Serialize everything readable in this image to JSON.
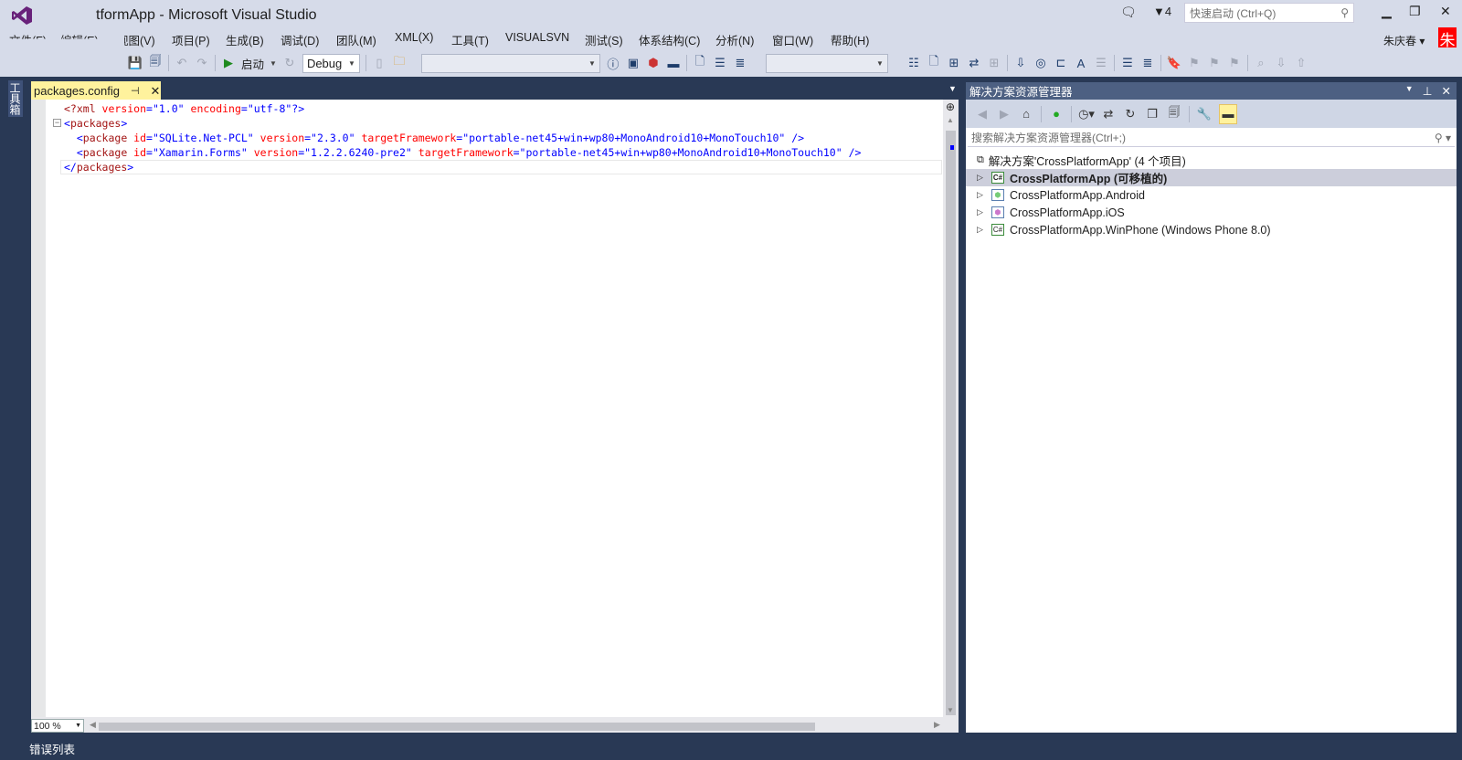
{
  "window": {
    "title": "tformApp - Microsoft Visual Studio",
    "notification_count": "4",
    "quick_launch_placeholder": "快速启动 (Ctrl+Q)",
    "user": "朱庆春",
    "user_avatar": "朱"
  },
  "menu": [
    "文件(F)",
    "编辑(E)",
    "视图(V)",
    "项目(P)",
    "生成(B)",
    "调试(D)",
    "团队(M)",
    "XML(X)",
    "工具(T)",
    "VISUALSVN",
    "测试(S)",
    "体系结构(C)",
    "分析(N)",
    "窗口(W)",
    "帮助(H)"
  ],
  "toolbar": {
    "start_label": "启动",
    "config": "Debug"
  },
  "editor": {
    "tab": "packages.config",
    "zoom": "100 %",
    "lines": [
      {
        "t": [
          [
            "<?xml ",
            "tagc"
          ],
          [
            "version",
            "ac"
          ],
          [
            "=\"",
            "vc"
          ],
          [
            "1.0",
            "vc"
          ],
          [
            "\" ",
            "vc"
          ],
          [
            "encoding",
            "ac"
          ],
          [
            "=\"utf-8\"",
            "vc"
          ],
          [
            "?>",
            "vc"
          ]
        ]
      },
      {
        "t": [
          [
            "<",
            "vc"
          ],
          [
            "packages",
            "tagc"
          ],
          [
            ">",
            "vc"
          ]
        ]
      },
      {
        "t": [
          [
            "  <",
            "vc"
          ],
          [
            "package ",
            "tagc"
          ],
          [
            "id",
            "ac"
          ],
          [
            "=\"SQLite.Net-PCL\" ",
            "vc"
          ],
          [
            "version",
            "ac"
          ],
          [
            "=\"2.3.0\" ",
            "vc"
          ],
          [
            "targetFramework",
            "ac"
          ],
          [
            "=\"portable-net45+win+wp80+MonoAndroid10+MonoTouch10\" />",
            "vc"
          ]
        ]
      },
      {
        "t": [
          [
            "  <",
            "vc"
          ],
          [
            "package ",
            "tagc"
          ],
          [
            "id",
            "ac"
          ],
          [
            "=\"Xamarin.Forms\" ",
            "vc"
          ],
          [
            "version",
            "ac"
          ],
          [
            "=\"1.2.2.6240-pre2\" ",
            "vc"
          ],
          [
            "targetFramework",
            "ac"
          ],
          [
            "=\"portable-net45+win+wp80+MonoAndroid10+MonoTouch10\" />",
            "vc"
          ]
        ]
      },
      {
        "t": [
          [
            "</",
            "vc"
          ],
          [
            "packages",
            "tagc"
          ],
          [
            ">",
            "vc"
          ]
        ]
      }
    ]
  },
  "solution_explorer": {
    "title": "解决方案资源管理器",
    "search_placeholder": "搜索解决方案资源管理器(Ctrl+;)",
    "solution": "解决方案'CrossPlatformApp' (4 个项目)",
    "projects": [
      "CrossPlatformApp (可移植的)",
      "CrossPlatformApp.Android",
      "CrossPlatformApp.iOS",
      "CrossPlatformApp.WinPhone (Windows Phone 8.0)"
    ]
  },
  "bottom": {
    "error_list": "错误列表"
  },
  "toolbox": "工具箱"
}
